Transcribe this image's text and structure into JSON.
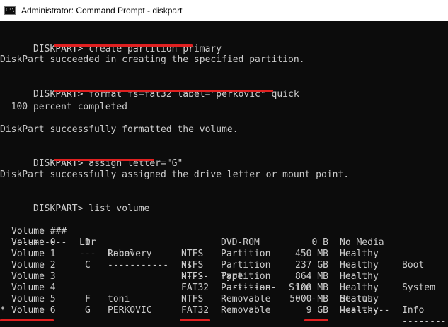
{
  "window": {
    "icon_text": "C:\\",
    "title": "Administrator: Command Prompt - diskpart"
  },
  "console": {
    "prompt": "DISKPART> ",
    "cmd1": "create partition primary",
    "out1": "DiskPart succeeded in creating the specified partition.",
    "cmd2": "format fs=fat32 label=\"perkovic\" quick",
    "progress": "  100 percent completed",
    "out2": "DiskPart successfully formatted the volume.",
    "cmd3": "assign letter=\"G\"",
    "out3": "DiskPart successfully assigned the drive letter or mount point.",
    "cmd4": "list volume"
  },
  "table": {
    "headers": [
      "Volume ###",
      "Ltr",
      "Label",
      "Fs",
      "Type",
      "Size",
      "Status",
      "Info"
    ],
    "separators": [
      "----------",
      "---",
      "-----------",
      "-----",
      "----------",
      "-------",
      "---------",
      "--------"
    ],
    "rows": [
      {
        "marker": " ",
        "volume": "Volume 0",
        "ltr": "D",
        "label": "",
        "fs": "",
        "type": "DVD-ROM",
        "size": "0 B",
        "status": "No Media",
        "info": ""
      },
      {
        "marker": " ",
        "volume": "Volume 1",
        "ltr": "",
        "label": "Recovery",
        "fs": "NTFS",
        "type": "Partition",
        "size": "450 MB",
        "status": "Healthy",
        "info": ""
      },
      {
        "marker": " ",
        "volume": "Volume 2",
        "ltr": "C",
        "label": "",
        "fs": "NTFS",
        "type": "Partition",
        "size": "237 GB",
        "status": "Healthy",
        "info": "Boot"
      },
      {
        "marker": " ",
        "volume": "Volume 3",
        "ltr": "",
        "label": "",
        "fs": "NTFS",
        "type": "Partition",
        "size": "864 MB",
        "status": "Healthy",
        "info": ""
      },
      {
        "marker": " ",
        "volume": "Volume 4",
        "ltr": "",
        "label": "",
        "fs": "FAT32",
        "type": "Partition",
        "size": "100 MB",
        "status": "Healthy",
        "info": "System"
      },
      {
        "marker": " ",
        "volume": "Volume 5",
        "ltr": "F",
        "label": "toni",
        "fs": "NTFS",
        "type": "Removable",
        "size": "5000 MB",
        "status": "Healthy",
        "info": ""
      },
      {
        "marker": "*",
        "volume": "Volume 6",
        "ltr": "G",
        "label": "PERKOVIC",
        "fs": "FAT32",
        "type": "Removable",
        "size": "9 GB",
        "status": "Healthy",
        "info": ""
      }
    ]
  },
  "colors": {
    "console_bg": "#0c0c0c",
    "console_fg": "#cccccc",
    "highlight_underline": "#e02020"
  }
}
